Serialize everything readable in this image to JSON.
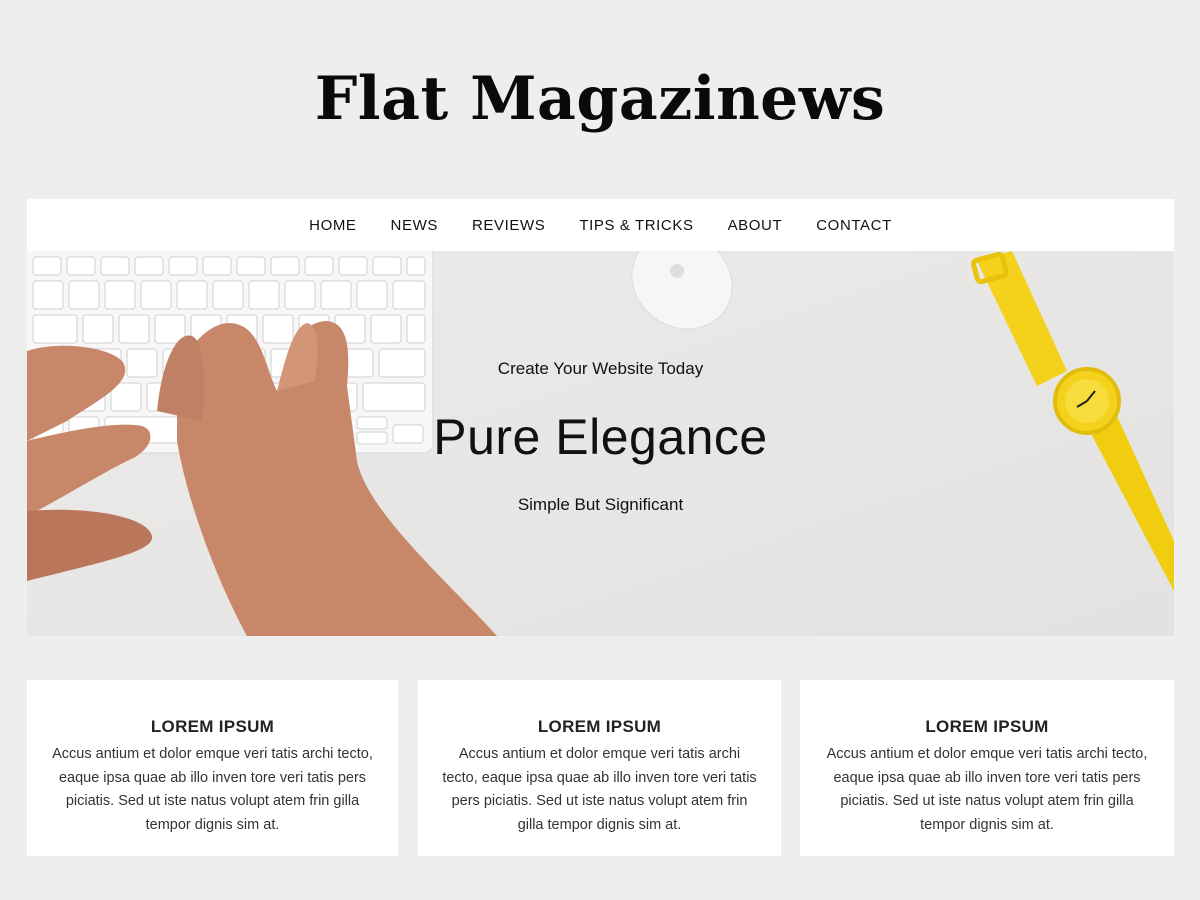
{
  "site": {
    "title": "Flat Magazinews"
  },
  "nav": {
    "items": [
      {
        "label": "HOME"
      },
      {
        "label": "NEWS"
      },
      {
        "label": "REVIEWS"
      },
      {
        "label": "TIPS & TRICKS"
      },
      {
        "label": "ABOUT"
      },
      {
        "label": "CONTACT"
      }
    ]
  },
  "hero": {
    "kicker": "Create Your Website Today",
    "title": "Pure Elegance",
    "subtitle": "Simple But Significant"
  },
  "cards": [
    {
      "title": "LOREM IPSUM",
      "text": "Accus antium et dolor emque veri tatis archi tecto, eaque ipsa quae ab illo inven tore veri tatis pers piciatis. Sed ut iste natus volupt atem frin gilla tempor dignis sim at."
    },
    {
      "title": "LOREM IPSUM",
      "text": "Accus antium et dolor emque veri tatis archi tecto, eaque ipsa quae ab illo inven tore veri tatis pers piciatis. Sed ut iste natus volupt atem frin gilla tempor dignis sim at."
    },
    {
      "title": "LOREM IPSUM",
      "text": "Accus antium et dolor emque veri tatis archi tecto, eaque ipsa quae ab illo inven tore veri tatis pers piciatis. Sed ut iste natus volupt atem frin gilla tempor dignis sim at."
    }
  ],
  "colors": {
    "page_background": "#eeeeee",
    "watch_yellow": "#f4d21c",
    "skin": "#c9876a"
  }
}
